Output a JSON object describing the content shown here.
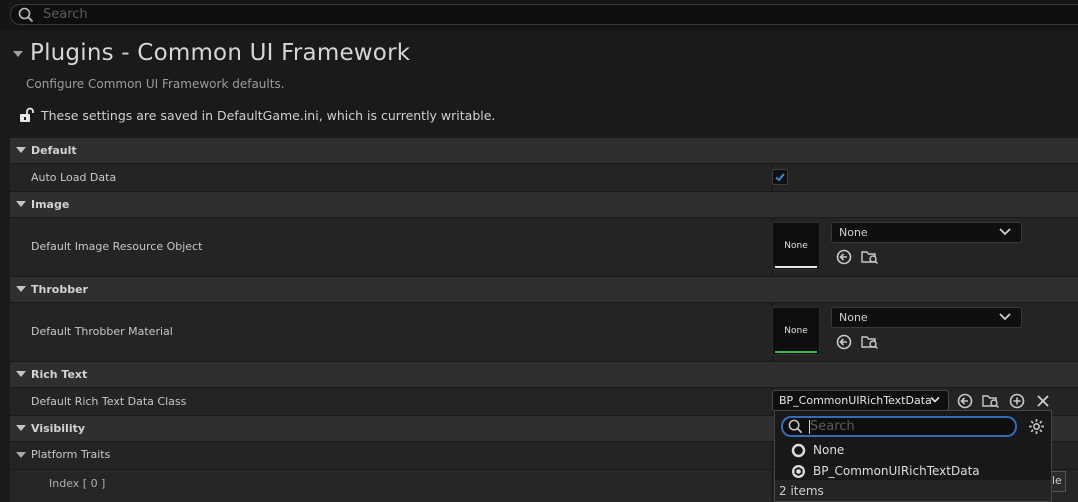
{
  "search": {
    "placeholder": "Search"
  },
  "header": {
    "title": "Plugins - Common UI Framework",
    "description": "Configure Common UI Framework defaults.",
    "writable_note": "These settings are saved in DefaultGame.ini, which is currently writable."
  },
  "categories": {
    "default": "Default",
    "image": "Image",
    "throbber": "Throbber",
    "rich_text": "Rich Text",
    "visibility": "Visibility"
  },
  "properties": {
    "auto_load_data": {
      "label": "Auto Load Data",
      "checked": true
    },
    "default_image_resource_object": {
      "label": "Default Image Resource Object",
      "thumb": "None",
      "value": "None"
    },
    "default_throbber_material": {
      "label": "Default Throbber Material",
      "thumb": "None",
      "value": "None"
    },
    "default_rich_text_data_class": {
      "label": "Default Rich Text Data Class",
      "value": "BP_CommonUIRichTextData"
    },
    "platform_traits": {
      "label": "Platform Traits"
    },
    "index_0": {
      "label": "Index [ 0 ]"
    }
  },
  "popup": {
    "search_placeholder": "Search",
    "items": [
      "None",
      "BP_CommonUIRichTextData"
    ],
    "count": "2 items"
  },
  "colors": {
    "accent_blue": "#2f6eb5",
    "check_blue": "#3a8ad8",
    "material_green": "#3cb54a"
  },
  "peek_text": "le"
}
